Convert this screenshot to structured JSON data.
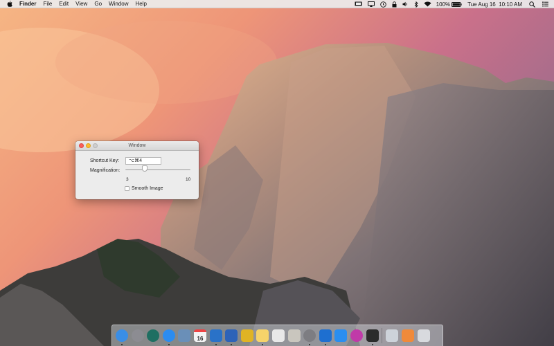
{
  "menubar": {
    "active_app": "Finder",
    "menus": [
      "File",
      "Edit",
      "View",
      "Go",
      "Window",
      "Help"
    ],
    "status": {
      "battery_percent": "100%",
      "datetime": "Tue Aug 16  10:10 AM"
    },
    "icons": [
      "display-icon",
      "airplay-icon",
      "time-machine-icon",
      "lock-icon",
      "volume-icon",
      "bluetooth-icon",
      "wifi-icon",
      "battery-icon",
      "spotlight-icon",
      "notification-center-icon"
    ]
  },
  "window": {
    "title": "Window",
    "shortcut_label": "Shortcut Key:",
    "shortcut_value": "⌥⌘4",
    "magnification_label": "Magnification:",
    "magnification_min": "3",
    "magnification_max": "10",
    "magnification_value_fraction": 0.3,
    "smooth_label": "Smooth Image",
    "smooth_checked": false
  },
  "dock": {
    "apps": [
      {
        "name": "finder",
        "color": "#3a8ee6",
        "running": true
      },
      {
        "name": "launchpad",
        "color": "#8c8c92",
        "running": false
      },
      {
        "name": "time-machine",
        "color": "#1f6f62",
        "running": false
      },
      {
        "name": "safari",
        "color": "#2b8cf0",
        "running": true
      },
      {
        "name": "preview",
        "color": "#6a8fb8",
        "running": false
      },
      {
        "name": "calendar",
        "color": "#f4f4f4",
        "running": false,
        "text": "16"
      },
      {
        "name": "outlook",
        "color": "#2a72c8",
        "running": true
      },
      {
        "name": "things",
        "color": "#2d63b8",
        "running": true
      },
      {
        "name": "slack",
        "color": "#e0b324",
        "running": false
      },
      {
        "name": "notes",
        "color": "#f6d36a",
        "running": true
      },
      {
        "name": "textedit",
        "color": "#e8e8e8",
        "running": false
      },
      {
        "name": "script-editor",
        "color": "#c9c6be",
        "running": false
      },
      {
        "name": "system-preferences",
        "color": "#7d7d82",
        "running": true
      },
      {
        "name": "xcode",
        "color": "#1e6fd0",
        "running": true
      },
      {
        "name": "app-store",
        "color": "#2a8ef0",
        "running": false
      },
      {
        "name": "flower-app",
        "color": "#c03aa8",
        "running": false
      },
      {
        "name": "terminal",
        "color": "#2b2b2b",
        "running": true
      }
    ],
    "right_items": [
      {
        "name": "screenshot-thumbnail",
        "color": "#cdd3da"
      },
      {
        "name": "downloads-stack",
        "color": "#f08a3a"
      },
      {
        "name": "trash",
        "color": "#d8dade"
      }
    ]
  }
}
